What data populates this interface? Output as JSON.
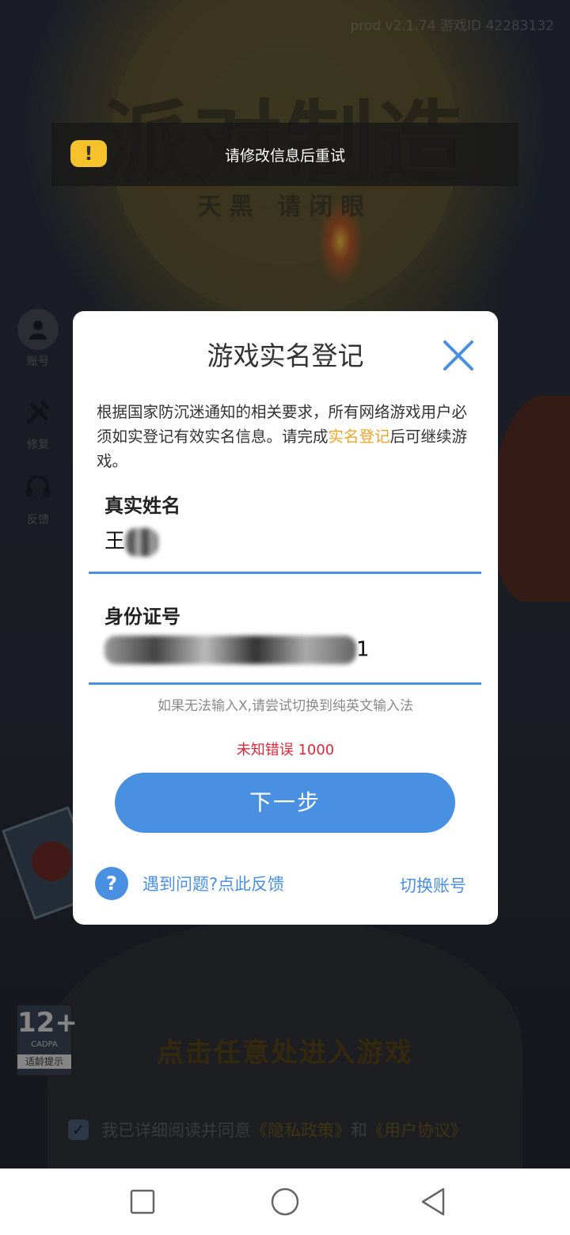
{
  "status": {
    "version": "prod v2.1.74 游戏ID 42283132"
  },
  "background": {
    "logo_title": "派对制造",
    "logo_subtitle": "天黑 请闭眼",
    "side_buttons": [
      {
        "label": "账号",
        "icon": "person-icon"
      },
      {
        "label": "修复",
        "icon": "tools-icon"
      },
      {
        "label": "反馈",
        "icon": "headset-icon"
      }
    ],
    "age_badge": {
      "rating": "12+",
      "org": "CADPA",
      "tip": "适龄提示"
    },
    "enter_hint": "点击任意处进入游戏",
    "agreement": {
      "prefix": "我已详细阅读并同意",
      "privacy": "《隐私政策》",
      "and": "和",
      "terms": "《用户协议》"
    }
  },
  "toast": {
    "icon": "warning-icon",
    "message": "请修改信息后重试"
  },
  "dialog": {
    "title": "游戏实名登记",
    "notice_before": "根据国家防沉迷通知的相关要求，所有网络游戏用户必须如实登记有效实名信息。请完成",
    "notice_highlight": "实名登记",
    "notice_after": "后可继续游戏。",
    "name_label": "真实姓名",
    "name_value_visible": "王",
    "id_label": "身份证号",
    "id_value_visible_tail": "1",
    "input_hint": "如果无法输入X,请尝试切换到纯英文输入法",
    "error_text": "未知错误 1000",
    "next_button": "下一步",
    "help_link": "遇到问题?点此反馈",
    "switch_account": "切换账号"
  },
  "colors": {
    "accent": "#4a90e2",
    "highlight": "#f2a425",
    "error": "#e0283a",
    "toast_icon": "#f5c22b"
  }
}
